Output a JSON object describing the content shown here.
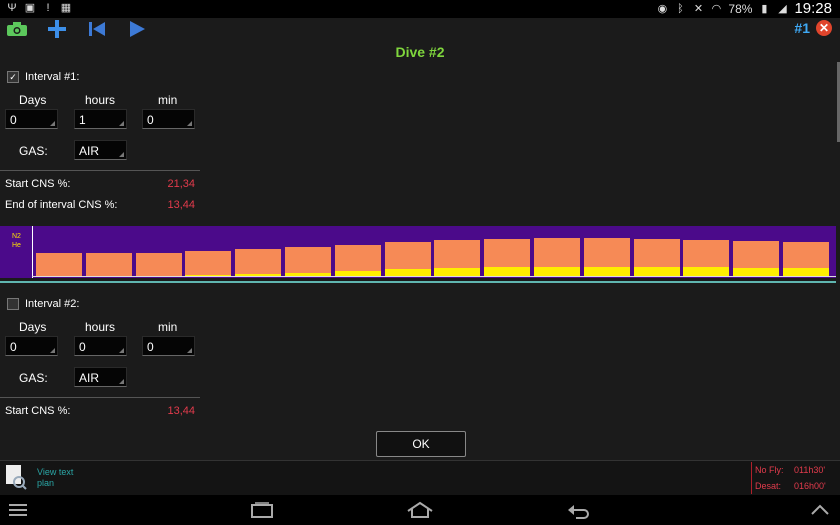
{
  "status_bar": {
    "time": "19:28",
    "battery": "78%"
  },
  "toolbar": {
    "dive_number": "#1"
  },
  "title": "Dive #2",
  "intervals": [
    {
      "label": "Interval #1:",
      "checked": true,
      "days_label": "Days",
      "hours_label": "hours",
      "min_label": "min",
      "days": "0",
      "hours": "1",
      "min": "0",
      "gas_label": "GAS:",
      "gas": "AIR",
      "start_cns_label": "Start CNS %:",
      "start_cns": "21,34",
      "end_cns_label": "End of interval CNS %:",
      "end_cns": "13,44"
    },
    {
      "label": "Interval #2:",
      "checked": false,
      "days_label": "Days",
      "hours_label": "hours",
      "min_label": "min",
      "days": "0",
      "hours": "0",
      "min": "0",
      "gas_label": "GAS:",
      "gas": "AIR",
      "start_cns_label": "Start CNS %:",
      "start_cns": "13,44"
    }
  ],
  "chart": {
    "n2_label": "N2",
    "he_label": "He"
  },
  "chart_data": {
    "type": "bar",
    "series": [
      {
        "name": "N2",
        "values": [
          0.44,
          0.45,
          0.45,
          0.48,
          0.51,
          0.55,
          0.6,
          0.65,
          0.69,
          0.72,
          0.73,
          0.73,
          0.72,
          0.7,
          0.68,
          0.66
        ]
      },
      {
        "name": "He",
        "values": [
          0,
          0,
          0,
          0.01,
          0.03,
          0.06,
          0.1,
          0.13,
          0.15,
          0.17,
          0.18,
          0.18,
          0.17,
          0.17,
          0.16,
          0.15
        ]
      }
    ],
    "colors": {
      "n2": "#f68a56",
      "he": "#ffee00",
      "background": "#4b0a8a"
    }
  },
  "ok_label": "OK",
  "view_text": "View text plan",
  "no_fly_label": "No Fly:",
  "no_fly_value": "011h30'",
  "desat_label": "Desat:",
  "desat_value": "016h00'"
}
